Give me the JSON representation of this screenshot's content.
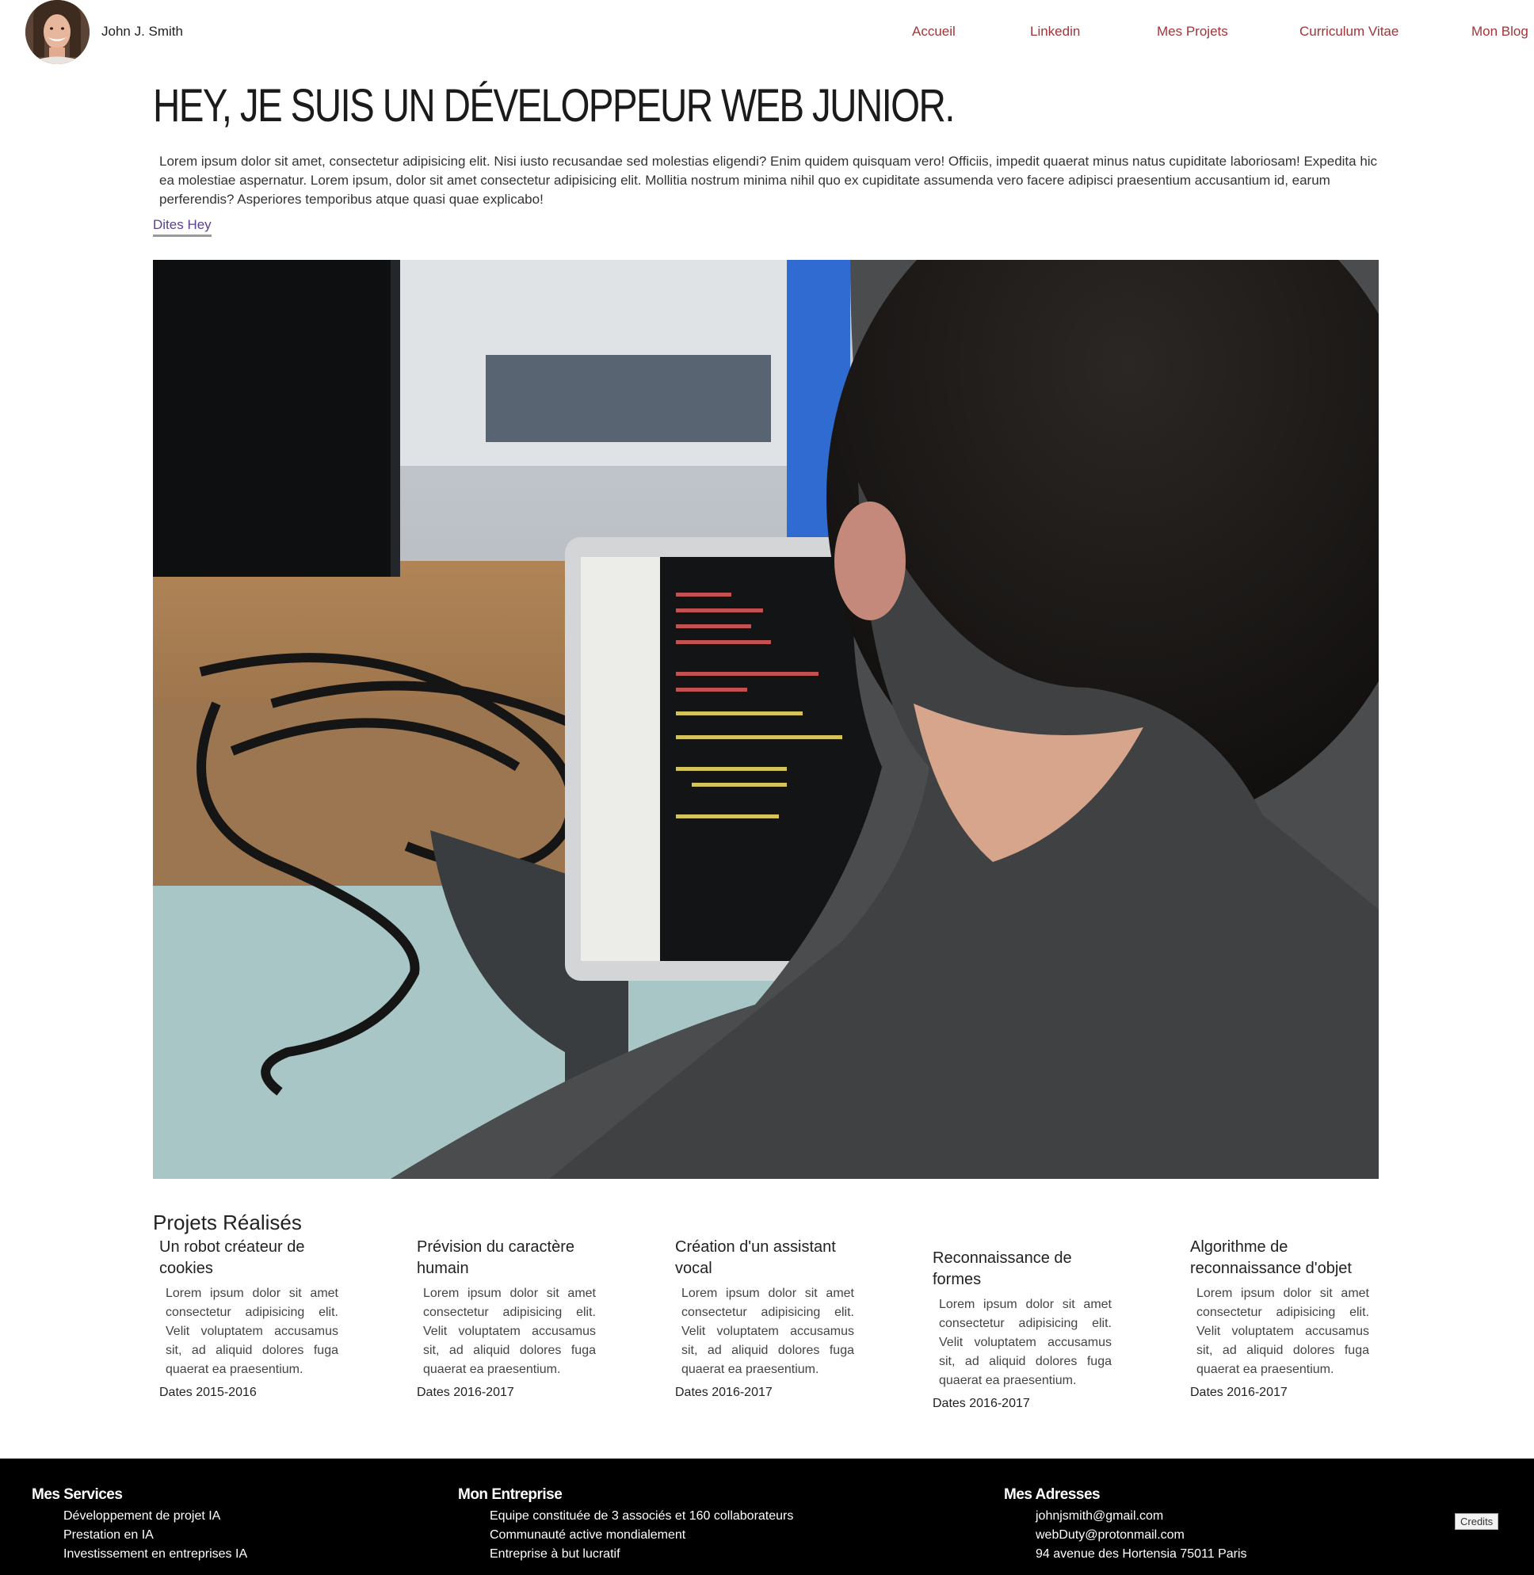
{
  "header": {
    "name": "John J. Smith",
    "nav": [
      "Accueil",
      "Linkedin",
      "Mes Projets",
      "Curriculum Vitae",
      "Mon Blog"
    ]
  },
  "hero": {
    "title": "HEY, JE SUIS UN DÉVELOPPEUR WEB JUNIOR.",
    "text": "Lorem ipsum dolor sit amet, consectetur adipisicing elit. Nisi iusto recusandae sed molestias eligendi? Enim quidem quisquam vero! Officiis, impedit quaerat minus natus cupiditate laboriosam! Expedita hic ea molestiae aspernatur. Lorem ipsum, dolor sit amet consectetur adipisicing elit. Mollitia nostrum minima nihil quo ex cupiditate assumenda vero facere adipisci praesentium accusantium id, earum perferendis? Asperiores temporibus atque quasi quae explicabo!",
    "cta": "Dites Hey"
  },
  "projects": {
    "title": "Projets Réalisés",
    "items": [
      {
        "title": "Un robot créateur de cookies",
        "text": "Lorem ipsum dolor sit amet consectetur adipisicing elit. Velit voluptatem accusamus sit, ad aliquid dolores fuga quaerat ea praesentium.",
        "dates": "Dates 2015-2016"
      },
      {
        "title": "Prévision du caractère humain",
        "text": "Lorem ipsum dolor sit amet consectetur adipisicing elit. Velit voluptatem accusamus sit, ad aliquid dolores fuga quaerat ea praesentium.",
        "dates": "Dates 2016-2017"
      },
      {
        "title": "Création d'un assistant vocal",
        "text": "Lorem ipsum dolor sit amet consectetur adipisicing elit. Velit voluptatem accusamus sit, ad aliquid dolores fuga quaerat ea praesentium.",
        "dates": "Dates 2016-2017"
      },
      {
        "title": "Reconnaissance de formes",
        "text": "Lorem ipsum dolor sit amet consectetur adipisicing elit. Velit voluptatem accusamus sit, ad aliquid dolores fuga quaerat ea praesentium.",
        "dates": "Dates 2016-2017"
      },
      {
        "title": "Algorithme de reconnaissance d'objet",
        "text": "Lorem ipsum dolor sit amet consectetur adipisicing elit. Velit voluptatem accusamus sit, ad aliquid dolores fuga quaerat ea praesentium.",
        "dates": "Dates 2016-2017"
      }
    ]
  },
  "footer": {
    "services": {
      "title": "Mes Services",
      "items": [
        "Développement de projet IA",
        "Prestation en IA",
        "Investissement en entreprises IA"
      ]
    },
    "company": {
      "title": "Mon Entreprise",
      "items": [
        "Equipe constituée de 3 associés et 160 collaborateurs",
        "Communauté active mondialement",
        "Entreprise à but lucratif"
      ]
    },
    "addresses": {
      "title": "Mes Adresses",
      "items": [
        "johnjsmith@gmail.com",
        "webDuty@protonmail.com",
        "94 avenue des Hortensia 75011 Paris"
      ]
    },
    "credits": "Credits"
  },
  "colors": {
    "nav_link": "#a0363a",
    "cta_link": "#5b3f92",
    "footer_bg": "#000000"
  }
}
